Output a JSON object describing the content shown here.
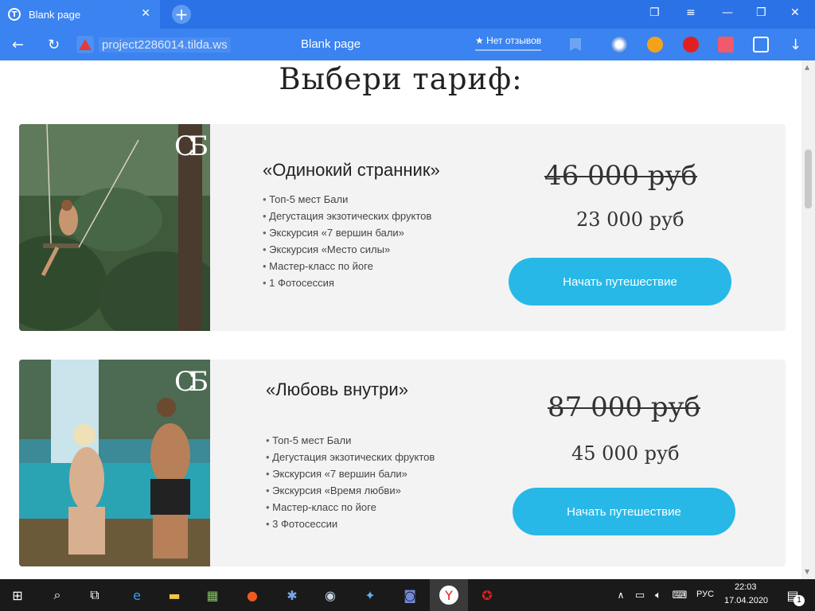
{
  "browser": {
    "tab_title": "Blank page",
    "tab_favicon": "tilda-icon",
    "url": "project2286014.tilda.ws",
    "page_title": "Blank page",
    "reviews_label": "★ Нет отзывов",
    "accent": "#3a83f0"
  },
  "page": {
    "heading": "Выбери тариф:",
    "logo_text": "СБ",
    "cards": [
      {
        "title": "«Одинокий странник»",
        "features": [
          "Топ-5 мест Бали",
          "Дегустация экзотических фруктов",
          "Экскурсия «7 вершин бали»",
          "Экскурсия «Место силы»",
          "Мастер-класс по йоге",
          "1 Фотосессия"
        ],
        "old_price": "46 000 руб",
        "new_price": "23 000 руб",
        "button": "Начать путешествие"
      },
      {
        "title": "«Любовь внутри»",
        "features": [
          "Топ-5 мест Бали",
          "Дегустация экзотических фруктов",
          "Экскурсия «7 вершин бали»",
          "Экскурсия «Время любви»",
          "Мастер-класс по йоге",
          "3 Фотосессии"
        ],
        "old_price": "87 000 руб",
        "new_price": "45 000 руб",
        "button": "Начать путешествие"
      }
    ],
    "button_color": "#27b8e8"
  },
  "taskbar": {
    "lang": "РУС",
    "time": "22:03",
    "date": "17.04.2020",
    "notifications": "1"
  }
}
